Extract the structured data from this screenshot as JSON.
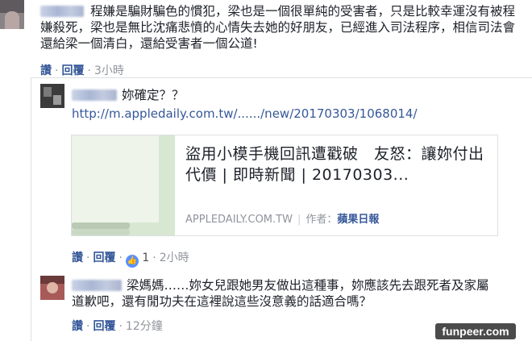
{
  "comment1": {
    "text": "程嫌是騙財騙色的慣犯，梁也是一個很單純的受害者，只是比較幸運沒有被程嫌殺死，梁也是無比沈痛悲憤的心情失去她的好朋友，已經進入司法程序，相信司法會還給梁一個清白，還給受害者一個公道!",
    "like_label": "讚",
    "reply_label": "回覆",
    "time": "3小時"
  },
  "reply1": {
    "text": "妳確定？？",
    "link": "http://m.appledaily.com.tw/....../new/20170303/1068014/",
    "card": {
      "title": "盜用小模手機回訊遭戳破　友怒：讓妳付出代價 | 即時新聞 | 20170303...",
      "domain": "APPLEDAILY.COM.TW",
      "author_label": "作者：",
      "publisher": "蘋果日報"
    },
    "like_label": "讚",
    "reply_label": "回覆",
    "reaction_count": "1",
    "time": "2小時"
  },
  "reply2": {
    "text": "梁媽媽……妳女兒跟她男友做出這種事，妳應該先去跟死者及家屬道歉吧，還有閒功夫在這裡說這些沒意義的話適合嗎？",
    "like_label": "讚",
    "reply_label": "回覆",
    "time": "12分鐘"
  },
  "watermark": "funpeer.com",
  "icons": {
    "like_badge": "thumbs-up-icon",
    "sep": "·"
  },
  "colors": {
    "link": "#365899",
    "meta": "#90949c",
    "like_badge": "#5890ff",
    "watermark_bg": "#4b4b4b"
  }
}
